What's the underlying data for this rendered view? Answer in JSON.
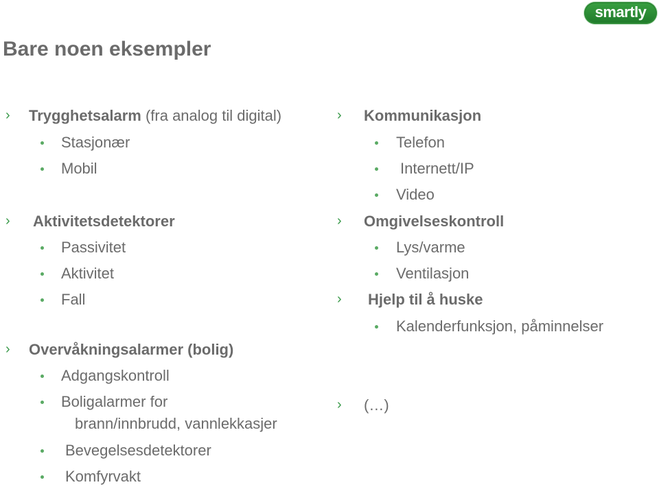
{
  "logo": {
    "text": "smartly"
  },
  "title": "Bare noen eksempler",
  "left_column": [
    {
      "heading": "Trygghetsalarm",
      "heading_suffix": " (fra analog til digital)",
      "items": [
        "Stasjonær",
        "Mobil"
      ]
    },
    {
      "heading": "Aktivitetsdetektorer",
      "heading_suffix": "",
      "items": [
        "Passivitet",
        "Aktivitet",
        "Fall"
      ]
    },
    {
      "heading": "Overvåkningsalarmer (bolig)",
      "heading_suffix": "",
      "items": [
        "Adgangskontroll",
        "Boligalarmer for",
        "brann/innbrudd,  vannlekkasjer",
        "Bevegelsesdetektorer",
        "Komfyrvakt"
      ]
    }
  ],
  "right_column": [
    {
      "heading": "Kommunikasjon",
      "items": [
        "Telefon",
        "Internett/IP",
        "Video"
      ]
    },
    {
      "heading": "Omgivelseskontroll",
      "items": [
        "Lys/varme",
        "Ventilasjon"
      ]
    },
    {
      "heading": "Hjelp til å huske",
      "items": [
        "Kalenderfunksjon, påminnelser"
      ]
    },
    {
      "heading": "(…)",
      "items": []
    }
  ],
  "colors": {
    "accent": "#3a9a4a",
    "text": "#6b6b6b",
    "logo": "#2a8a34"
  }
}
